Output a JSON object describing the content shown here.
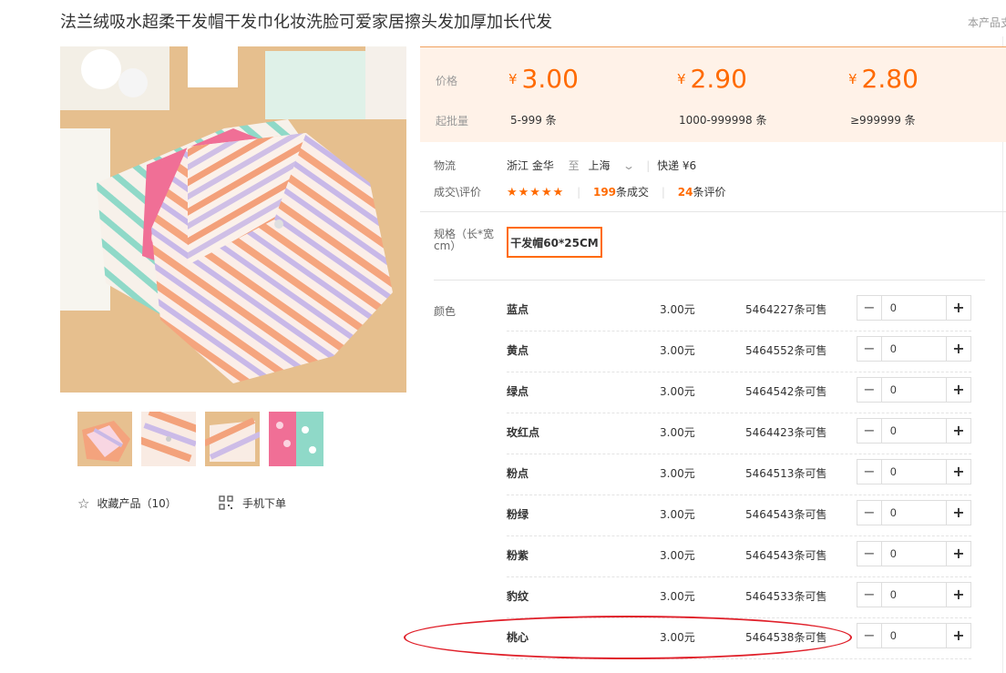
{
  "product": {
    "title": "法兰绒吸水超柔干发帽干发巾化妆洗脸可爱家居擦头发加厚加长代发",
    "corner_note": "本产品支"
  },
  "gallery": {
    "favorite": {
      "icon": "star-outline-icon",
      "label": "收藏产品（10）"
    },
    "mobile_order": {
      "icon": "qr-code-icon",
      "label": "手机下单"
    }
  },
  "pricing": {
    "price_label": "价格",
    "min_qty_label": "起批量",
    "currency": "¥",
    "tiers": [
      {
        "price": "3.00",
        "qty": "5-999 条"
      },
      {
        "price": "2.90",
        "qty": "1000-999998 条"
      },
      {
        "price": "2.80",
        "qty": "≥999999 条"
      }
    ],
    "accent_color": "#ff6a00"
  },
  "logistics": {
    "label": "物流",
    "from": "浙江 金华",
    "to_word": "至",
    "to": "上海",
    "chevron": "chevron-down-icon",
    "express": "快递 ¥6"
  },
  "deals": {
    "label": "成交\\评价",
    "stars": "★★★★★",
    "deal_count": "199",
    "deal_suffix": "条成交",
    "review_count": "24",
    "review_suffix": "条评价"
  },
  "spec": {
    "label": "规格（长*宽cm）",
    "selected": "干发帽60*25CM"
  },
  "colors": {
    "label": "颜色",
    "rows": [
      {
        "name": "蓝点",
        "price": "3.00元",
        "stock": "5464227条可售",
        "qty": "0"
      },
      {
        "name": "黄点",
        "price": "3.00元",
        "stock": "5464552条可售",
        "qty": "0"
      },
      {
        "name": "绿点",
        "price": "3.00元",
        "stock": "5464542条可售",
        "qty": "0"
      },
      {
        "name": "玫红点",
        "price": "3.00元",
        "stock": "5464423条可售",
        "qty": "0"
      },
      {
        "name": "粉点",
        "price": "3.00元",
        "stock": "5464513条可售",
        "qty": "0"
      },
      {
        "name": "粉绿",
        "price": "3.00元",
        "stock": "5464543条可售",
        "qty": "0"
      },
      {
        "name": "粉紫",
        "price": "3.00元",
        "stock": "5464543条可售",
        "qty": "0"
      },
      {
        "name": "豹纹",
        "price": "3.00元",
        "stock": "5464533条可售",
        "qty": "0"
      },
      {
        "name": "桃心",
        "price": "3.00元",
        "stock": "5464538条可售",
        "qty": "0"
      }
    ],
    "minus_symbol": "−",
    "plus_symbol": "+"
  }
}
